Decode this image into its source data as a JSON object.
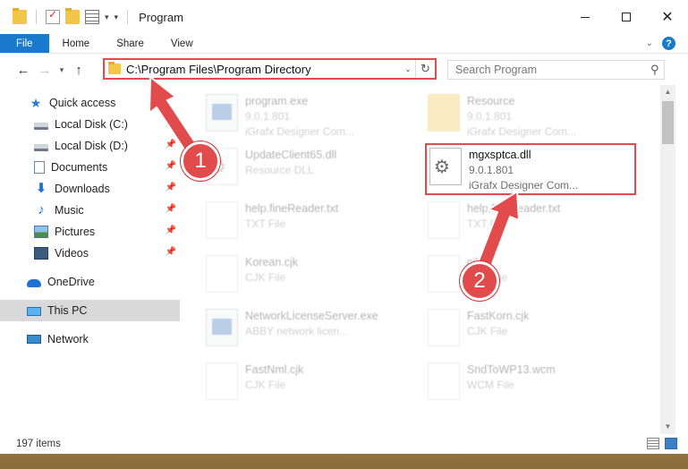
{
  "window": {
    "title": "Program",
    "min_icon": "—",
    "close_icon": "✕"
  },
  "ribbon": {
    "tabs": [
      "File",
      "Home",
      "Share",
      "View"
    ]
  },
  "address": {
    "path": "C:\\Program Files\\Program Directory"
  },
  "search": {
    "placeholder": "Search Program"
  },
  "sidebar": {
    "items": [
      {
        "label": "Quick access",
        "icon": "star-icon"
      },
      {
        "label": "Local Disk (C:)",
        "icon": "disk-icon"
      },
      {
        "label": "Local Disk (D:)",
        "icon": "disk-icon"
      },
      {
        "label": "Documents",
        "icon": "documents-icon"
      },
      {
        "label": "Downloads",
        "icon": "downloads-icon"
      },
      {
        "label": "Music",
        "icon": "music-icon"
      },
      {
        "label": "Pictures",
        "icon": "pictures-icon"
      },
      {
        "label": "Videos",
        "icon": "videos-icon"
      },
      {
        "label": "OneDrive",
        "icon": "onedrive-icon"
      },
      {
        "label": "This PC",
        "icon": "pc-icon"
      },
      {
        "label": "Network",
        "icon": "network-icon"
      }
    ],
    "selected": "This PC"
  },
  "files": [
    {
      "name": "program.exe",
      "sub1": "9.0.1.801",
      "sub2": "iGrafx Designer Com..."
    },
    {
      "name": "Resource",
      "sub1": "9.0.1.801",
      "sub2": "iGrafx Designer Com..."
    },
    {
      "name": "UpdateClient65.dll",
      "sub1": "Resource DLL",
      "sub2": ""
    },
    {
      "name": "mgxsptca.dll",
      "sub1": "9.0.1.801",
      "sub2": "iGrafx Designer Com..."
    },
    {
      "name": "help.fineReader.txt",
      "sub1": "TXT File",
      "sub2": ""
    },
    {
      "name": "help.fineReader.txt",
      "sub1": "TXT File",
      "sub2": ""
    },
    {
      "name": "Korean.cjk",
      "sub1": "CJK File",
      "sub2": ""
    },
    {
      "name": "cjk",
      "sub1": "CJK File",
      "sub2": ""
    },
    {
      "name": "NetworkLicenseServer.exe",
      "sub1": "ABBY network licen...",
      "sub2": ""
    },
    {
      "name": "FastKorn.cjk",
      "sub1": "CJK File",
      "sub2": ""
    },
    {
      "name": "FastNml.cjk",
      "sub1": "CJK File",
      "sub2": ""
    },
    {
      "name": "SndToWP13.wcm",
      "sub1": "WCM File",
      "sub2": ""
    }
  ],
  "status": {
    "count": "197 items"
  },
  "callouts": {
    "first": "1",
    "second": "2"
  },
  "colors": {
    "accent": "#1979ca",
    "highlight_red": "#e24b4b"
  }
}
